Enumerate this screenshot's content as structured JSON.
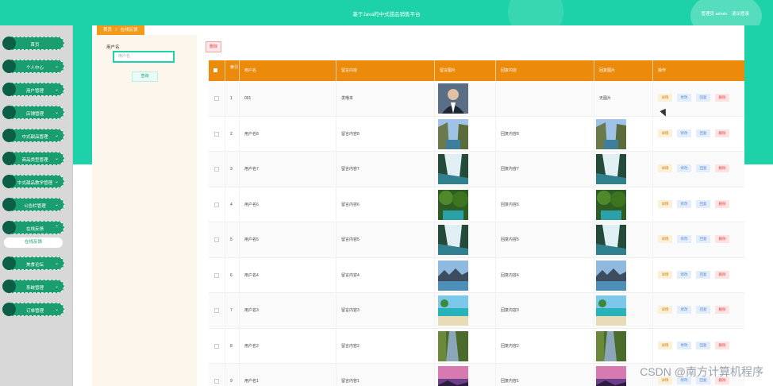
{
  "header": {
    "title": "基于Java的中式甜品销售平台",
    "user_label": "管理员 admin",
    "logout": "退出登录"
  },
  "sidebar": {
    "items": [
      {
        "label": "首页",
        "has_chevron": false
      },
      {
        "label": "个人中心",
        "has_chevron": true
      },
      {
        "label": "用户管理",
        "has_chevron": true
      },
      {
        "label": "店铺管理",
        "has_chevron": true
      },
      {
        "label": "中式甜品管理",
        "has_chevron": true
      },
      {
        "label": "商品类型管理",
        "has_chevron": true
      },
      {
        "label": "中式甜品教学管理",
        "has_chevron": true
      },
      {
        "label": "公告栏管理",
        "has_chevron": true
      },
      {
        "label": "在线反馈",
        "has_chevron": true,
        "expanded": true
      },
      {
        "label": "美食论坛",
        "has_chevron": true
      },
      {
        "label": "系统管理",
        "has_chevron": true
      },
      {
        "label": "订单管理",
        "has_chevron": true
      }
    ],
    "submenu": "在线反馈"
  },
  "breadcrumb": {
    "home": "首页",
    "separator": "/",
    "current": "在线反馈"
  },
  "search": {
    "label": "用户名",
    "placeholder": "用户名",
    "button": "查询"
  },
  "toolbar": {
    "delete": "删除"
  },
  "table": {
    "headers": [
      "",
      "索引",
      "用户名",
      "留言内容",
      "留言图片",
      "回复内容",
      "回复图片",
      "操作"
    ],
    "actions": {
      "detail": "详情",
      "edit": "修改",
      "reply": "回复",
      "delete": "删除"
    },
    "rows": [
      {
        "index": "1",
        "username": "001",
        "message": "发哦本",
        "msg_img": "portrait",
        "reply": "",
        "reply_img_text": "无图片"
      },
      {
        "index": "2",
        "username": "用户名8",
        "message": "留言内容8",
        "msg_img": "canyon",
        "reply": "回复内容8",
        "reply_img_text": ""
      },
      {
        "index": "3",
        "username": "用户名7",
        "message": "留言内容7",
        "msg_img": "waterfall",
        "reply": "回复内容7",
        "reply_img_text": ""
      },
      {
        "index": "4",
        "username": "用户名6",
        "message": "留言内容6",
        "msg_img": "forest",
        "reply": "回复内容6",
        "reply_img_text": ""
      },
      {
        "index": "5",
        "username": "用户名5",
        "message": "留言内容5",
        "msg_img": "waterfall",
        "reply": "回复内容5",
        "reply_img_text": ""
      },
      {
        "index": "6",
        "username": "用户名4",
        "message": "留言内容4",
        "msg_img": "lake",
        "reply": "回复内容4",
        "reply_img_text": ""
      },
      {
        "index": "7",
        "username": "用户名3",
        "message": "留言内容3",
        "msg_img": "beach",
        "reply": "回复内容3",
        "reply_img_text": ""
      },
      {
        "index": "8",
        "username": "用户名2",
        "message": "留言内容2",
        "msg_img": "river",
        "reply": "回复内容2",
        "reply_img_text": ""
      },
      {
        "index": "9",
        "username": "用户名1",
        "message": "留言内容1",
        "msg_img": "sunset",
        "reply": "回复内容1",
        "reply_img_text": ""
      }
    ]
  },
  "watermark": "CSDN @南方计算机程序",
  "colors": {
    "primary": "#1dd2a8",
    "header_orange": "#ec8a0c",
    "menu": "#1a9e6f"
  }
}
